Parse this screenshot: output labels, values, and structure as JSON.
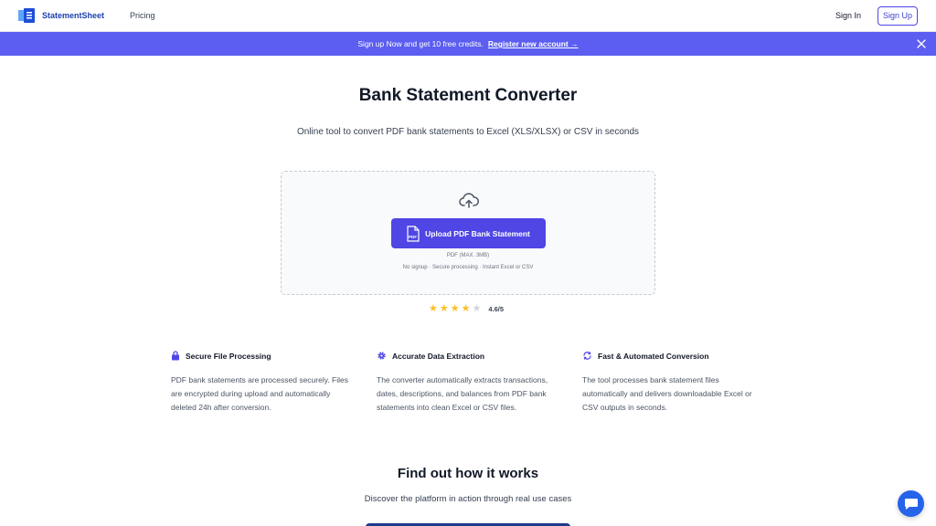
{
  "nav": {
    "brand": "StatementSheet",
    "pricing": "Pricing",
    "signin": "Sign In",
    "signup": "Sign Up"
  },
  "banner": {
    "text": "Sign up Now and get 10 free credits.",
    "link": "Register new account →"
  },
  "hero": {
    "title": "Bank Statement Converter",
    "subtitle": "Online tool to convert PDF bank statements to Excel (XLS/XLSX) or CSV in seconds"
  },
  "upload": {
    "button": "Upload PDF Bank Statement",
    "pdf_badge": "PDF",
    "limit": "PDF (MAX. 3MB)",
    "note": "No signup · Secure processing · Instant Excel or CSV"
  },
  "rating": {
    "value": 4.6,
    "text": "4.6/5",
    "stars_total": 5
  },
  "features": [
    {
      "title": "Secure File Processing",
      "icon": "lock-icon",
      "text": "PDF bank statements are processed securely. Files are encrypted during upload and automatically deleted 24h after conversion."
    },
    {
      "title": "Accurate Data Extraction",
      "icon": "gear-icon",
      "text": "The converter automatically extracts transactions, dates, descriptions, and balances from PDF bank statements into clean Excel or CSV files."
    },
    {
      "title": "Fast & Automated Conversion",
      "icon": "refresh-icon",
      "text": "The tool processes bank statement files automatically and delivers downloadable Excel or CSV outputs in seconds."
    }
  ],
  "how": {
    "title": "Find out how it works",
    "subtitle": "Discover the platform in action through real use cases"
  },
  "colors": {
    "accent": "#4f46e5",
    "banner": "#5b5ef0",
    "star": "#fbbf24",
    "star_empty": "#d1d5db"
  }
}
